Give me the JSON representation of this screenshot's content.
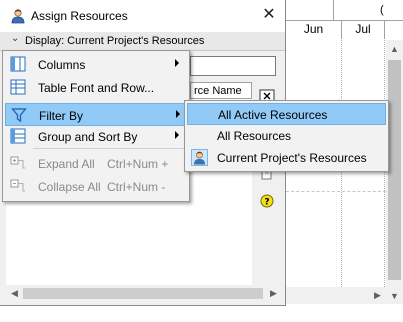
{
  "gantt": {
    "top_label": "(",
    "months": [
      "Jun",
      "Jul"
    ]
  },
  "dialog": {
    "title": "Assign Resources",
    "close_label": "✕",
    "display_label": "Display: Current Project's Resources",
    "grid_column_header": "rce Name"
  },
  "context_menu": {
    "items": [
      {
        "label": "Columns",
        "icon": "columns-icon",
        "submenu": true,
        "enabled": true
      },
      {
        "label": "Table Font and Row...",
        "icon": "table-font-icon",
        "submenu": false,
        "enabled": true
      },
      {
        "label": "Filter By",
        "icon": "filter-icon",
        "submenu": true,
        "enabled": true,
        "highlighted": true
      },
      {
        "label": "Group and Sort By",
        "icon": "group-sort-icon",
        "submenu": true,
        "enabled": true
      },
      {
        "label": "Expand All",
        "accelerator": "Ctrl+Num +",
        "icon": "expand-all-icon",
        "enabled": false
      },
      {
        "label": "Collapse All",
        "accelerator": "Ctrl+Num -",
        "icon": "collapse-all-icon",
        "enabled": false
      }
    ]
  },
  "filter_submenu": {
    "items": [
      {
        "label": "All Active Resources",
        "highlighted": true
      },
      {
        "label": "All Resources"
      },
      {
        "label": "Current Project's Resources",
        "icon": "resource-person-icon"
      }
    ]
  },
  "colors": {
    "highlight": "#91c9f7",
    "menu_bg": "#f2f2f2",
    "dialog_bg": "#f0f0f0"
  }
}
